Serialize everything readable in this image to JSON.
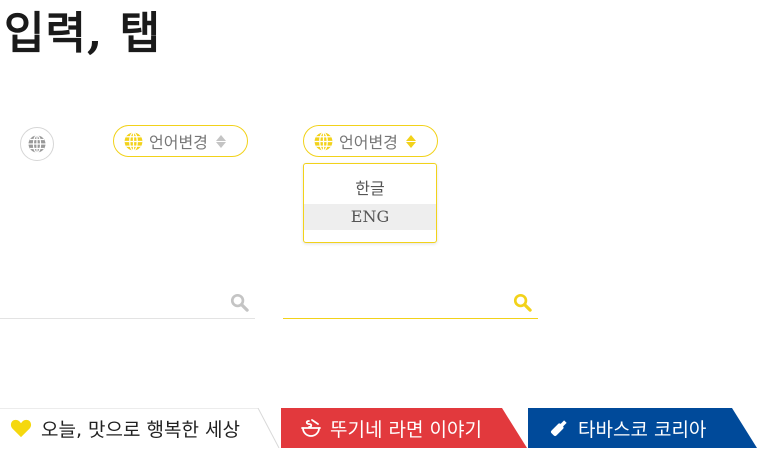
{
  "page": {
    "title": "입력, 탭"
  },
  "language_select": {
    "label": "언어변경",
    "options": [
      "한글",
      "ENG"
    ],
    "highlighted_option": "ENG",
    "accent_color": "#f2d21a"
  },
  "tabs": [
    {
      "label": "오늘, 맛으로 행복한 세상",
      "icon": "heart-icon",
      "color": "#ffffff",
      "active": true
    },
    {
      "label": "뚜기네 라면 이야기",
      "icon": "noodle-bowl-icon",
      "color": "#e2393d"
    },
    {
      "label": "타바스코 코리아",
      "icon": "bottle-icon",
      "color": "#004a9a"
    }
  ]
}
